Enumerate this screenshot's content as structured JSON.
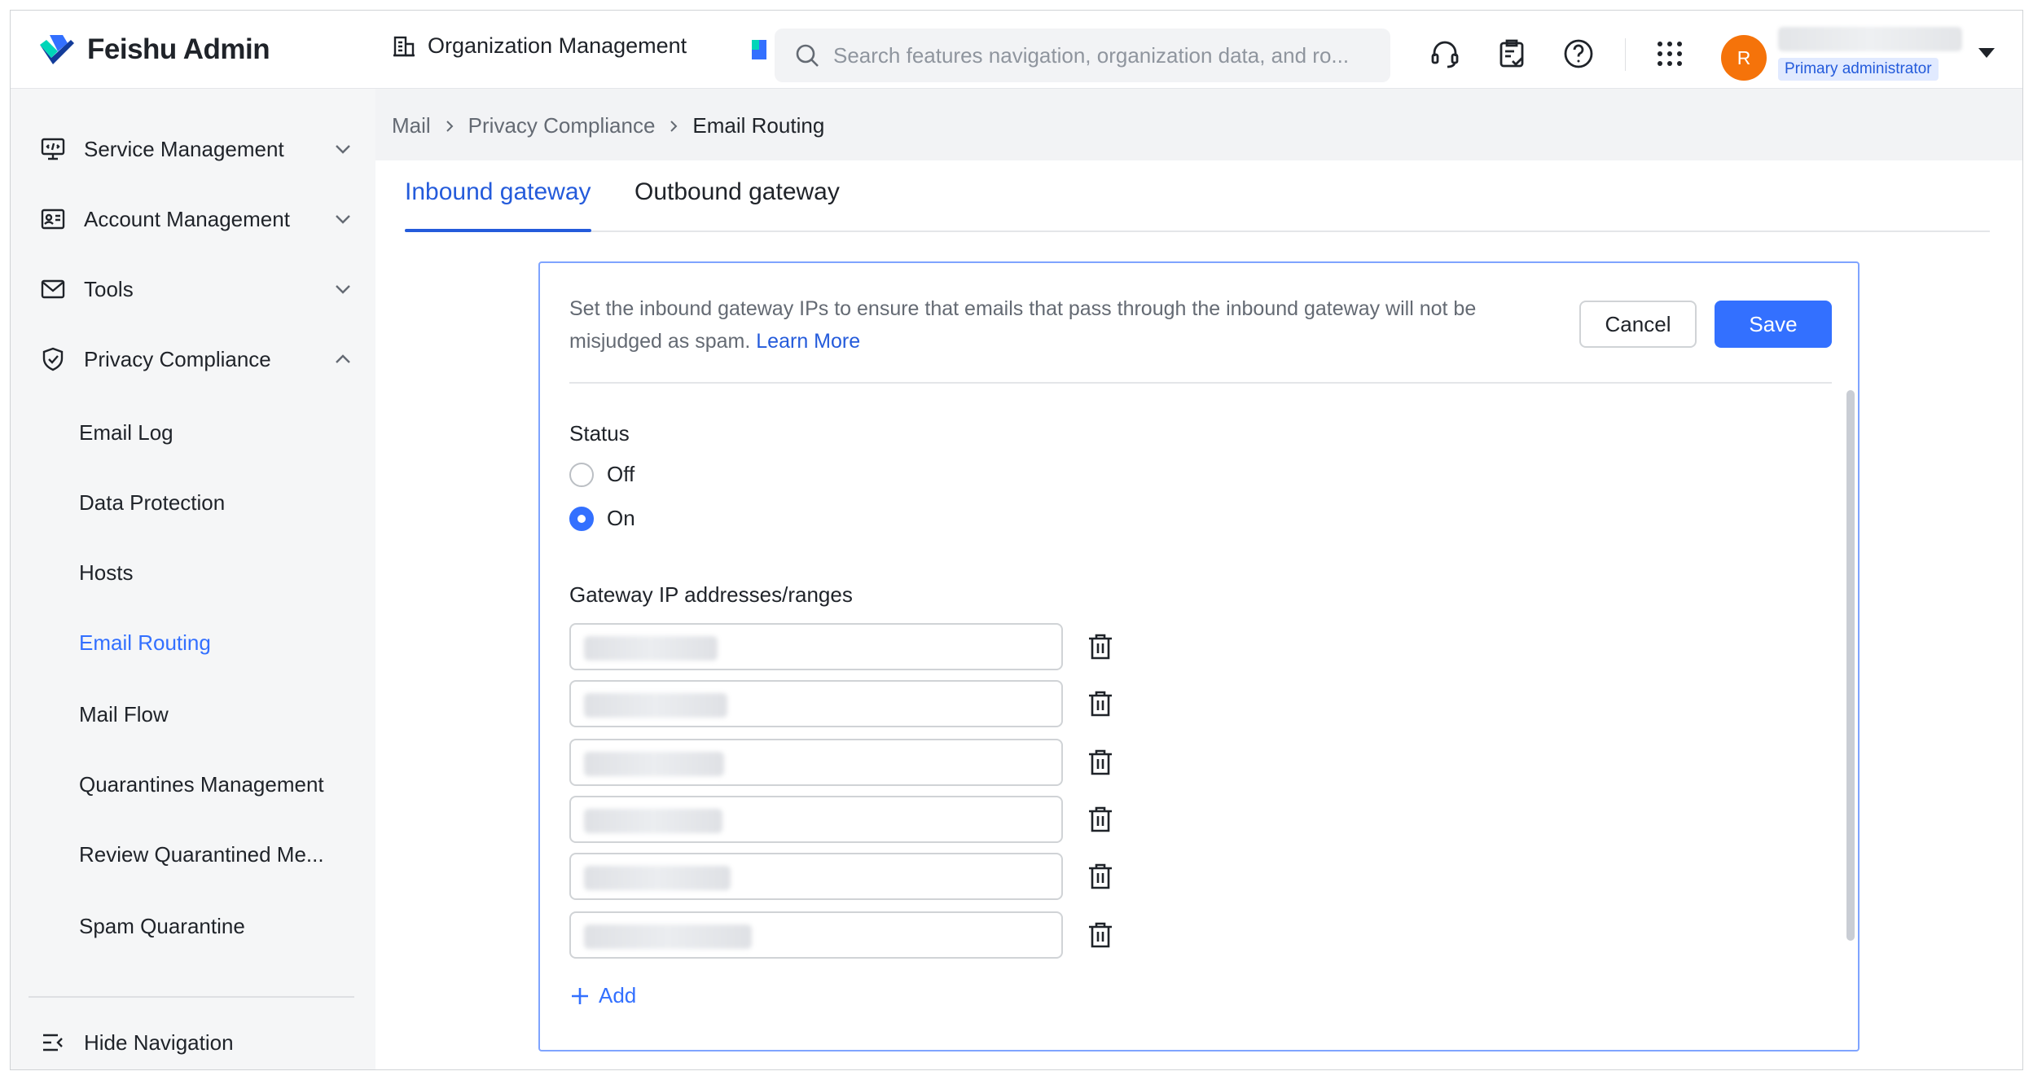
{
  "app": {
    "title": "Feishu Admin"
  },
  "topbar": {
    "org_management": "Organization Management",
    "search_placeholder": "Search features navigation, organization data, and ro...",
    "avatar_initial": "R",
    "user_role": "Primary administrator"
  },
  "sidebar": {
    "groups": [
      {
        "label": "Service Management",
        "icon": "monitor-icon",
        "expanded": false
      },
      {
        "label": "Account Management",
        "icon": "id-card-icon",
        "expanded": false
      },
      {
        "label": "Tools",
        "icon": "mail-icon",
        "expanded": false
      },
      {
        "label": "Privacy Compliance",
        "icon": "shield-icon",
        "expanded": true
      }
    ],
    "sub_items": [
      {
        "label": "Email Log"
      },
      {
        "label": "Data Protection"
      },
      {
        "label": "Hosts"
      },
      {
        "label": "Email Routing",
        "active": true
      },
      {
        "label": "Mail Flow"
      },
      {
        "label": "Quarantines Management"
      },
      {
        "label": "Review Quarantined Me..."
      },
      {
        "label": "Spam Quarantine"
      }
    ],
    "hide_nav": "Hide Navigation"
  },
  "breadcrumb": [
    "Mail",
    "Privacy Compliance",
    "Email Routing"
  ],
  "tabs": [
    {
      "label": "Inbound gateway",
      "active": true
    },
    {
      "label": "Outbound gateway",
      "active": false
    }
  ],
  "panel": {
    "description": "Set the inbound gateway IPs to ensure that emails that pass through the inbound gateway will not be misjudged as spam.",
    "learn_more": "Learn More",
    "cancel": "Cancel",
    "save": "Save",
    "status_label": "Status",
    "status_options": [
      {
        "label": "Off",
        "checked": false
      },
      {
        "label": "On",
        "checked": true
      }
    ],
    "gateway_label": "Gateway IP addresses/ranges",
    "add": "Add"
  },
  "colors": {
    "accent": "#3370ff",
    "accent_text": "#245bdb",
    "avatar": "#f5730a",
    "sidebar_bg": "#f5f6f7"
  }
}
